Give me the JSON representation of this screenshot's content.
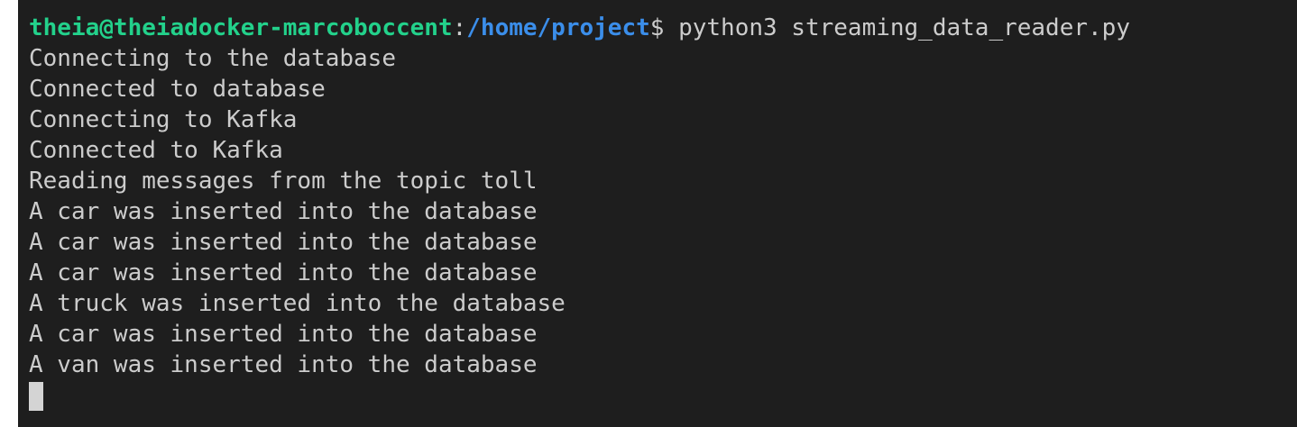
{
  "prompt": {
    "user_host": "theia@theiadocker-marcoboccent",
    "separator": ":",
    "path": "/home/project",
    "symbol": "$",
    "command": " python3 streaming_data_reader.py"
  },
  "output": [
    "Connecting to the database",
    "Connected to database",
    "Connecting to Kafka",
    "Connected to Kafka",
    "Reading messages from the topic toll",
    "A car was inserted into the database",
    "A car was inserted into the database",
    "A car was inserted into the database",
    "A truck was inserted into the database",
    "A car was inserted into the database",
    "A van was inserted into the database"
  ],
  "colors": {
    "background": "#1e1e1e",
    "text": "#cccccc",
    "user_host": "#23d18b",
    "path": "#3b8eea",
    "cursor": "#d4d4d4"
  }
}
